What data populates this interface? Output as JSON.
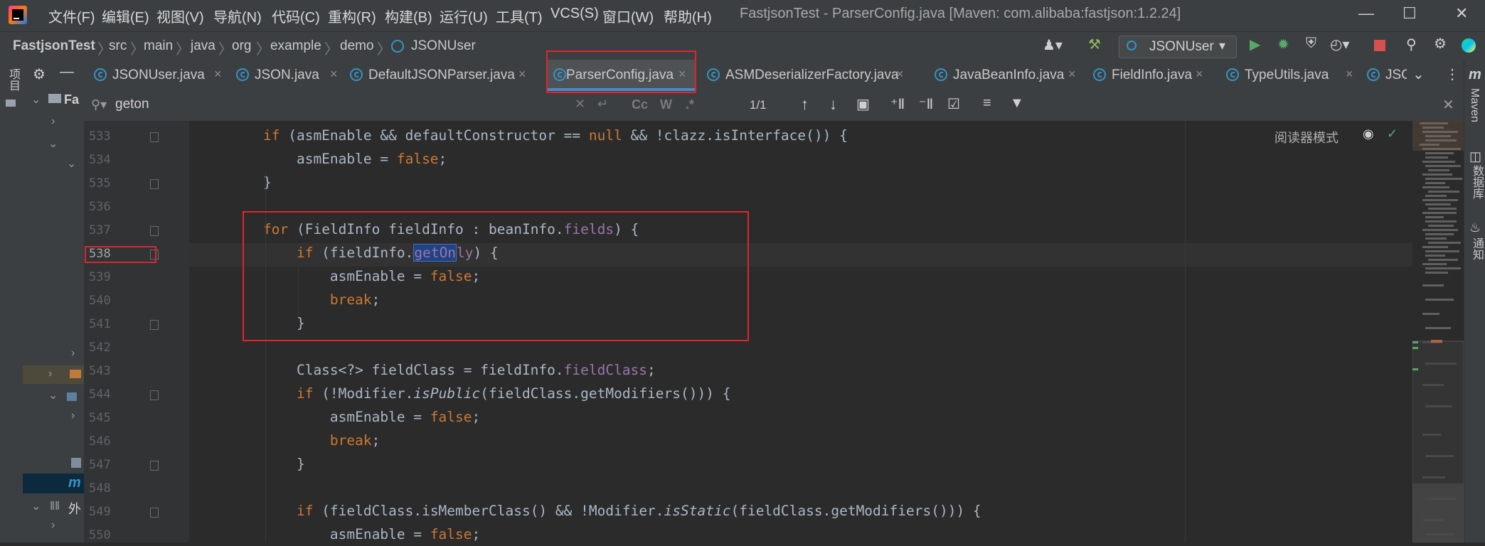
{
  "menu": {
    "items": [
      "文件(F)",
      "编辑(E)",
      "视图(V)",
      "导航(N)",
      "代码(C)",
      "重构(R)",
      "构建(B)",
      "运行(U)",
      "工具(T)",
      "VCS(S)",
      "窗口(W)",
      "帮助(H)"
    ],
    "title": "FastjsonTest - ParserConfig.java [Maven: com.alibaba:fastjson:1.2.24]"
  },
  "breadcrumb": {
    "items": [
      "FastjsonTest",
      "src",
      "main",
      "java",
      "org",
      "example",
      "demo",
      "JSONUser"
    ]
  },
  "run_config": {
    "label": "JSONUser"
  },
  "tabs": [
    {
      "label": "JSONUser.java"
    },
    {
      "label": "JSON.java"
    },
    {
      "label": "DefaultJSONParser.java"
    },
    {
      "label": "ParserConfig.java"
    },
    {
      "label": "ASMDeserializerFactory.java"
    },
    {
      "label": "JavaBeanInfo.java"
    },
    {
      "label": "FieldInfo.java"
    },
    {
      "label": "TypeUtils.java"
    },
    {
      "label": "JSC"
    }
  ],
  "find": {
    "query": "geton",
    "match_count": "1/1",
    "case_label": "Cc",
    "word_label": "W",
    "regex_label": ".*"
  },
  "editor": {
    "reader_mode_label": "阅读器模式",
    "line_numbers": [
      "533",
      "534",
      "535",
      "536",
      "537",
      "538",
      "539",
      "540",
      "541",
      "542",
      "543",
      "544",
      "545",
      "546",
      "547",
      "548",
      "549",
      "550"
    ]
  },
  "project_panel": {
    "root_label": "Fa",
    "external_label": "外",
    "title": "项目"
  },
  "right_strip": {
    "maven_label": "Maven",
    "database_label": "数据库",
    "notifications_label": "通知"
  },
  "colors": {
    "keyword": "#cc7832",
    "field": "#9876aa",
    "default_code": "#a9b7c6",
    "highlight_box": "#e0242d",
    "accent": "#4a88c7"
  }
}
